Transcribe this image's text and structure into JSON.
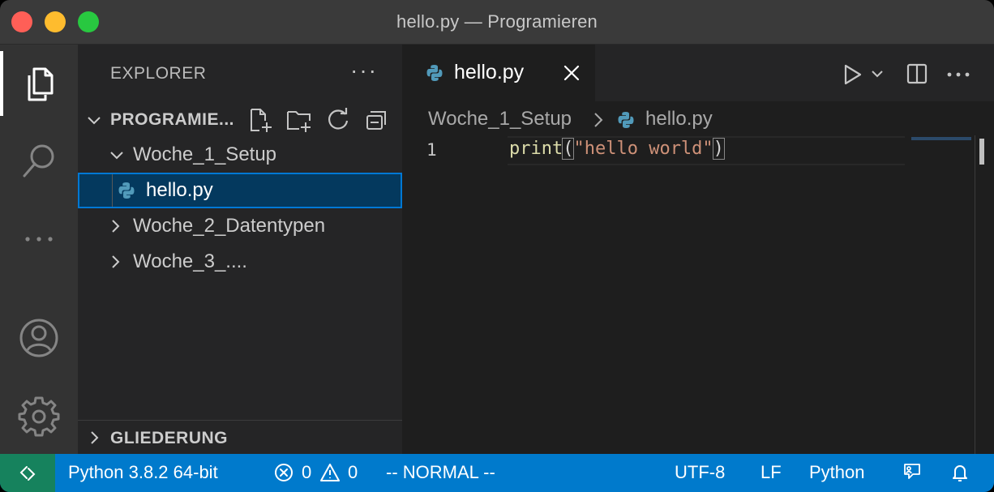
{
  "window": {
    "title": "hello.py — Programieren"
  },
  "explorer": {
    "header": "EXPLORER",
    "more": "···",
    "workspace": "PROGRAMIE...",
    "tree": [
      {
        "label": "Woche_1_Setup",
        "expanded": true
      },
      {
        "label": "hello.py",
        "selected": true,
        "icon": "python-icon"
      },
      {
        "label": "Woche_2_Datentypen",
        "expanded": false
      },
      {
        "label": "Woche_3_....",
        "expanded": false
      }
    ],
    "outline": "GLIEDERUNG"
  },
  "editor": {
    "tab": {
      "label": "hello.py",
      "icon": "python-icon"
    },
    "breadcrumb": {
      "folder": "Woche_1_Setup",
      "file": "hello.py"
    },
    "line_number": "1",
    "code": {
      "fn": "print",
      "open_paren": "(",
      "string": "\"hello world\"",
      "close_paren": ")"
    }
  },
  "statusbar": {
    "interpreter": "Python 3.8.2 64-bit",
    "errors": "0",
    "warnings": "0",
    "mode": "-- NORMAL --",
    "encoding": "UTF-8",
    "eol": "LF",
    "language": "Python"
  },
  "colors": {
    "statusbar": "#007acc",
    "remote": "#16825d",
    "selection": "#04395e",
    "focus_border": "#0078d4"
  }
}
